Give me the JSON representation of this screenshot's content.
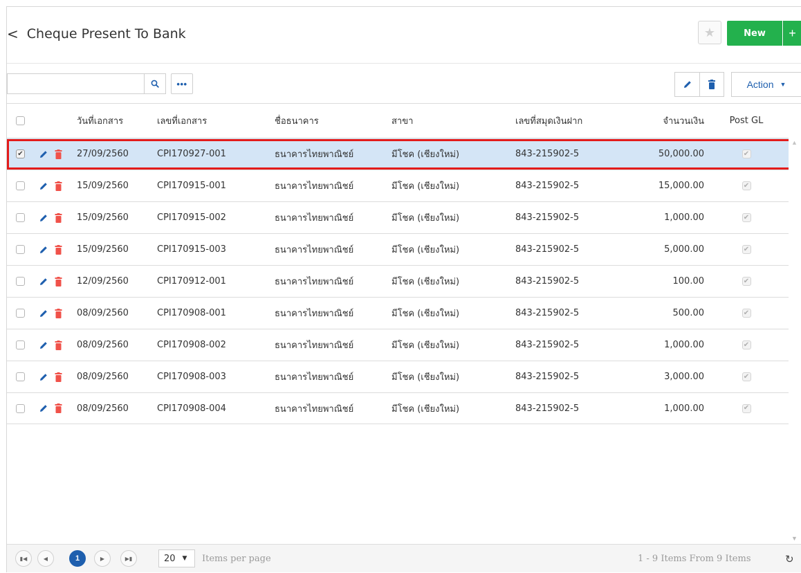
{
  "header": {
    "back_glyph": "<",
    "title": "Cheque Present To Bank",
    "new_label": "New",
    "plus_label": "+"
  },
  "toolbar": {
    "search_value": "",
    "search_placeholder": "",
    "more_label": "•••",
    "action_label": "Action"
  },
  "grid": {
    "columns": [
      "วันที่เอกสาร",
      "เลขที่เอกสาร",
      "ชื่อธนาคาร",
      "สาขา",
      "เลขที่สมุดเงินฝาก",
      "จำนวนเงิน",
      "Post GL"
    ],
    "rows": [
      {
        "date": "27/09/2560",
        "doc_no": "CPI170927-001",
        "bank": "ธนาคารไทยพาณิชย์",
        "branch": "มีโชค (เชียงใหม่)",
        "account": "843-215902-5",
        "amount": "50,000.00",
        "post_gl": true,
        "selected": true
      },
      {
        "date": "15/09/2560",
        "doc_no": "CPI170915-001",
        "bank": "ธนาคารไทยพาณิชย์",
        "branch": "มีโชค (เชียงใหม่)",
        "account": "843-215902-5",
        "amount": "15,000.00",
        "post_gl": true,
        "selected": false
      },
      {
        "date": "15/09/2560",
        "doc_no": "CPI170915-002",
        "bank": "ธนาคารไทยพาณิชย์",
        "branch": "มีโชค (เชียงใหม่)",
        "account": "843-215902-5",
        "amount": "1,000.00",
        "post_gl": true,
        "selected": false
      },
      {
        "date": "15/09/2560",
        "doc_no": "CPI170915-003",
        "bank": "ธนาคารไทยพาณิชย์",
        "branch": "มีโชค (เชียงใหม่)",
        "account": "843-215902-5",
        "amount": "5,000.00",
        "post_gl": true,
        "selected": false
      },
      {
        "date": "12/09/2560",
        "doc_no": "CPI170912-001",
        "bank": "ธนาคารไทยพาณิชย์",
        "branch": "มีโชค (เชียงใหม่)",
        "account": "843-215902-5",
        "amount": "100.00",
        "post_gl": true,
        "selected": false
      },
      {
        "date": "08/09/2560",
        "doc_no": "CPI170908-001",
        "bank": "ธนาคารไทยพาณิชย์",
        "branch": "มีโชค (เชียงใหม่)",
        "account": "843-215902-5",
        "amount": "500.00",
        "post_gl": true,
        "selected": false
      },
      {
        "date": "08/09/2560",
        "doc_no": "CPI170908-002",
        "bank": "ธนาคารไทยพาณิชย์",
        "branch": "มีโชค (เชียงใหม่)",
        "account": "843-215902-5",
        "amount": "1,000.00",
        "post_gl": true,
        "selected": false
      },
      {
        "date": "08/09/2560",
        "doc_no": "CPI170908-003",
        "bank": "ธนาคารไทยพาณิชย์",
        "branch": "มีโชค (เชียงใหม่)",
        "account": "843-215902-5",
        "amount": "3,000.00",
        "post_gl": true,
        "selected": false
      },
      {
        "date": "08/09/2560",
        "doc_no": "CPI170908-004",
        "bank": "ธนาคารไทยพาณิชย์",
        "branch": "มีโชค (เชียงใหม่)",
        "account": "843-215902-5",
        "amount": "1,000.00",
        "post_gl": true,
        "selected": false
      }
    ]
  },
  "pager": {
    "current_page": "1",
    "page_size": "20",
    "items_per_page_label": "Items per page",
    "summary": "1 - 9 Items From 9 Items"
  },
  "icons": {
    "back": "chevron-left-icon",
    "favorite": "star-icon",
    "search": "search-icon",
    "more": "ellipsis-icon",
    "edit": "pencil-icon",
    "delete": "trash-icon",
    "dropdown": "caret-down-icon",
    "refresh": "refresh-icon",
    "first_page": "first-page-icon",
    "prev_page": "prev-page-icon",
    "next_page": "next-page-icon",
    "last_page": "last-page-icon"
  },
  "colors": {
    "primary": "#1e5fae",
    "new_button": "#23b14d",
    "delete_icon": "#f0524a",
    "selected_row": "#d4e5f6",
    "highlight_border": "#e31b1b"
  }
}
